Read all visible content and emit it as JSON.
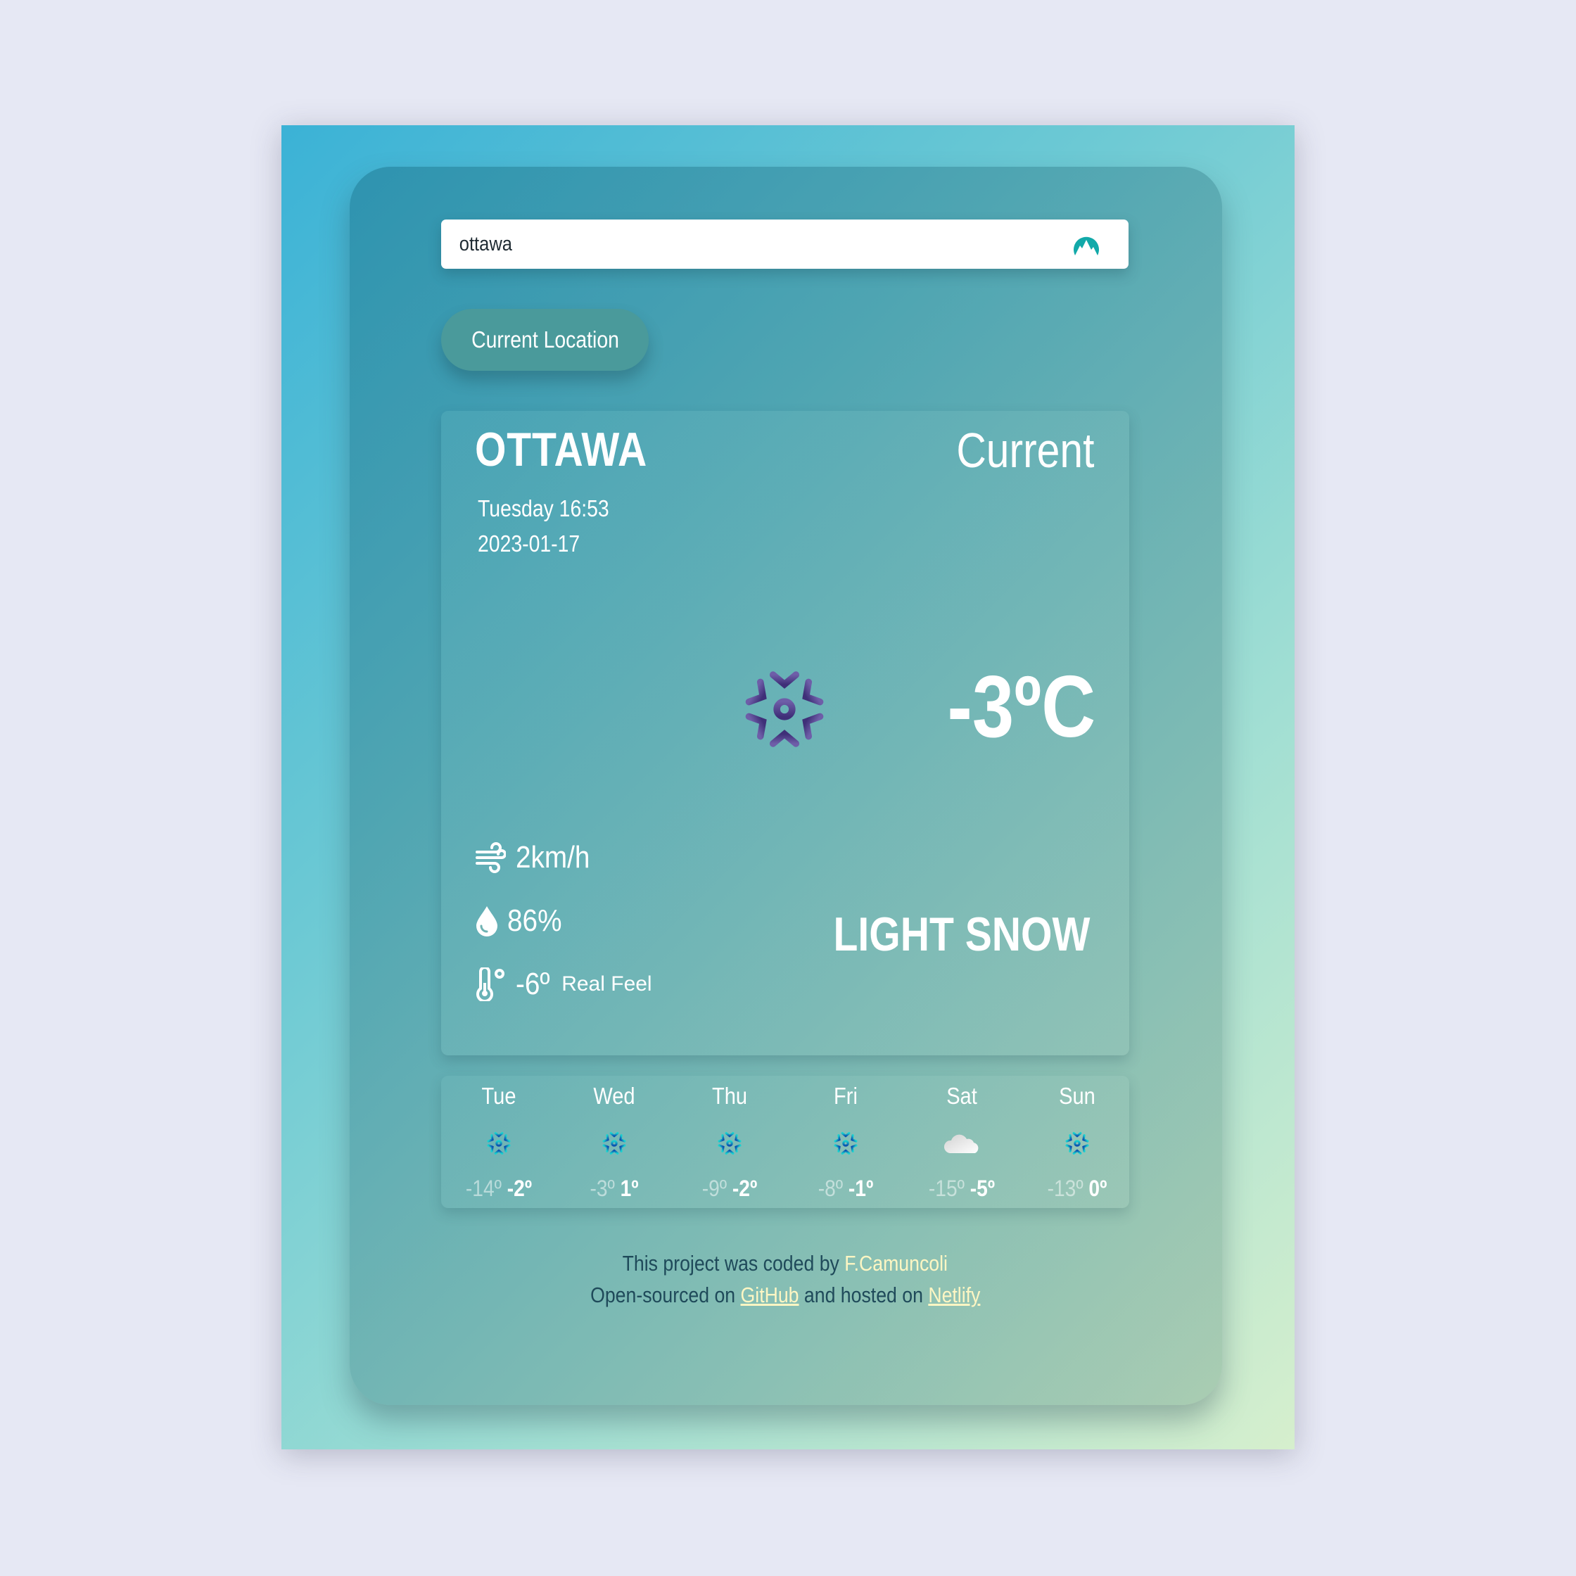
{
  "search": {
    "value": "ottawa",
    "icon": "nordvpn-mountain-icon",
    "icon_color": "#12a9a9"
  },
  "current_location_button": {
    "label": "Current Location"
  },
  "current": {
    "city": "OTTAWA",
    "label": "Current",
    "day_time": "Tuesday 16:53",
    "date": "2023-01-17",
    "icon": "snowflake-icon",
    "temperature": "-3ºC",
    "wind": "2km/h",
    "humidity": "86%",
    "real_feel": "-6º",
    "real_feel_label": "Real Feel",
    "description": "LIGHT SNOW"
  },
  "forecast": [
    {
      "day": "Tue",
      "icon": "snowflake-icon",
      "min": "-14º",
      "max": "-2º"
    },
    {
      "day": "Wed",
      "icon": "snowflake-icon",
      "min": "-3º",
      "max": "1º"
    },
    {
      "day": "Thu",
      "icon": "snowflake-icon",
      "min": "-9º",
      "max": "-2º"
    },
    {
      "day": "Fri",
      "icon": "snowflake-icon",
      "min": "-8º",
      "max": "-1º"
    },
    {
      "day": "Sat",
      "icon": "cloud-icon",
      "min": "-15º",
      "max": "-5º"
    },
    {
      "day": "Sun",
      "icon": "snowflake-icon",
      "min": "-13º",
      "max": "0º"
    }
  ],
  "footer": {
    "line1_prefix": "This project was coded by ",
    "author": "F.Camuncoli",
    "line2_prefix": "Open-sourced on ",
    "github_label": "GitHub",
    "line2_middle": " and hosted on ",
    "netlify_label": "Netlify"
  },
  "colors": {
    "page_background": "#e6e8f4",
    "gradient_start": "#3bb2d6",
    "gradient_end": "#d6efcd",
    "button": "#4a9a9b",
    "link": "#fdf6c3",
    "footer_text": "#1f4a5a"
  }
}
